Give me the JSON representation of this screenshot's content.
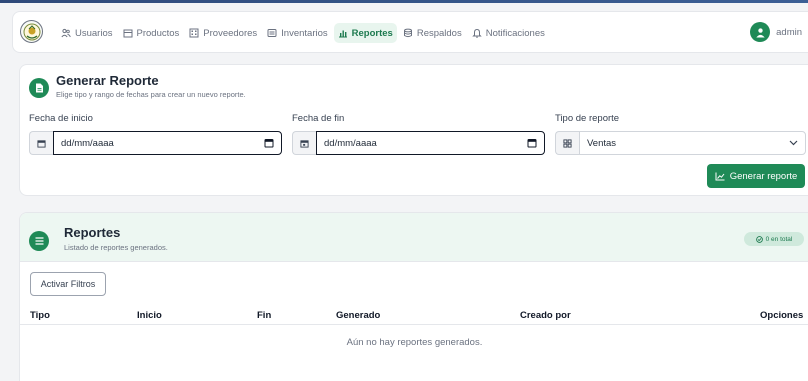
{
  "navbar": {
    "items": [
      {
        "label": "Usuarios",
        "icon": "users-icon",
        "active": false
      },
      {
        "label": "Productos",
        "icon": "box-icon",
        "active": false
      },
      {
        "label": "Proveedores",
        "icon": "building-icon",
        "active": false
      },
      {
        "label": "Inventarios",
        "icon": "inventory-icon",
        "active": false
      },
      {
        "label": "Reportes",
        "icon": "chart-icon",
        "active": true
      },
      {
        "label": "Respaldos",
        "icon": "database-icon",
        "active": false
      },
      {
        "label": "Notificaciones",
        "icon": "bell-icon",
        "active": false
      }
    ],
    "user": {
      "name": "admin",
      "icon": "user-icon"
    }
  },
  "generate": {
    "title": "Generar Reporte",
    "subtitle": "Elige tipo y rango de fechas para crear un nuevo reporte.",
    "start_label": "Fecha de inicio",
    "start_value": "dd/mm/aaaa",
    "end_label": "Fecha de fin",
    "end_value": "dd/mm/aaaa",
    "type_label": "Tipo de reporte",
    "type_value": "Ventas",
    "button_label": "Generar reporte"
  },
  "reports": {
    "title": "Reportes",
    "subtitle": "Listado de reportes generados.",
    "badge": "0 en total",
    "filter_button": "Activar Filtros",
    "columns": [
      "Tipo",
      "Inicio",
      "Fin",
      "Generado",
      "Creado por",
      "Opciones"
    ],
    "empty_message": "Aún no hay reportes generados."
  },
  "colors": {
    "accent": "#1f8a57",
    "accent_light": "#edf7f2",
    "active_nav_bg": "#e8f5ee"
  }
}
